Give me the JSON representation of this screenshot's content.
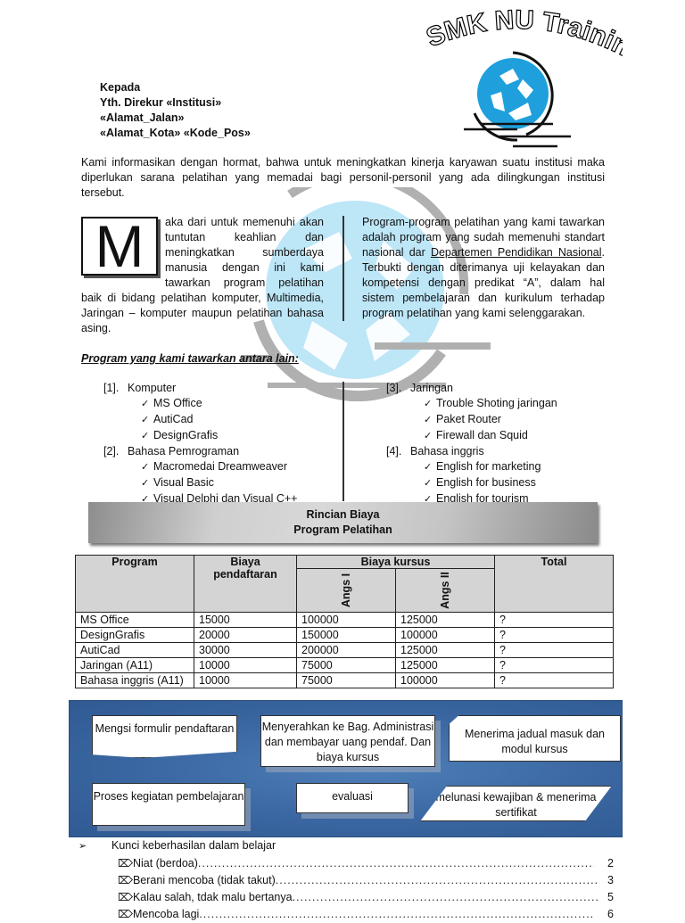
{
  "logo": {
    "title": "SMK NU Training Center",
    "emblem_icon": "recycle-icon",
    "accent_color": "#1fa0dc"
  },
  "address": {
    "line1": "Kepada",
    "line2": "Yth. Direkur «Institusi»",
    "line3": "«Alamat_Jalan»",
    "line4": "«Alamat_Kota» «Kode_Pos»"
  },
  "intro": "Kami informasikan dengan hormat, bahwa untuk meningkatkan kinerja karyawan suatu institusi maka diperlukan sarana pelatihan yang memadai bagi personil-personil yang ada dilingkungan institusi tersebut.",
  "left_column": {
    "drop_cap": "M",
    "text": "aka dari untuk memenuhi akan tuntutan keahlian dan meningkatkan sumberdaya manusia dengan ini kami tawarkan program pelatihan baik di bidang pelatihan komputer, Multimedia, Jaringan – komputer maupun pelatihan bahasa asing."
  },
  "right_column": {
    "text_before": "Program-program pelatihan yang kami tawarkan adalah program yang sudah memenuhi standart nasional dar ",
    "link_text": "Departemen Pendidikan Nasional",
    "text_after": ". Terbukti dengan diterimanya uji kelayakan dan kompetensi dengan predikat “A”, dalam hal sistem pembelajaran dan kurikulum terhadap program pelatihan yang kami selenggarakan."
  },
  "programs": {
    "heading": "Program yang kami tawarkan antara lain:",
    "check_icon": "✓",
    "left": [
      {
        "num": "[1].",
        "name": "Komputer",
        "items": [
          "MS Office",
          "AutiCad",
          "DesignGrafis"
        ]
      },
      {
        "num": "[2].",
        "name": "Bahasa Pemrograman",
        "items": [
          "Macromedai Dreamweaver",
          "Visual Basic",
          "Visual Delphi dan Visual C++"
        ]
      }
    ],
    "right": [
      {
        "num": "[3].",
        "name": "Jaringan",
        "items": [
          "Trouble Shoting jaringan",
          "Paket Router",
          "Firewall dan Squid"
        ]
      },
      {
        "num": "[4].",
        "name": "Bahasa inggris",
        "items": [
          "English for marketing",
          "English for business",
          "English for tourism"
        ]
      }
    ]
  },
  "banner": {
    "line1": "Rincian Biaya",
    "line2": "Program Pelatihan"
  },
  "fee_table": {
    "headers": {
      "program": "Program",
      "registration": "Biaya pendaftaran",
      "course": "Biaya kursus",
      "installment1": "Angs I",
      "installment2": "Angs II",
      "total": "Total"
    },
    "rows": [
      [
        "MS Office",
        "15000",
        "100000",
        "125000",
        "?"
      ],
      [
        "DesignGrafis",
        "20000",
        "150000",
        "100000",
        "?"
      ],
      [
        "AutiCad",
        "30000",
        "200000",
        "125000",
        "?"
      ],
      [
        "Jaringan (A11)",
        "10000",
        "75000",
        "125000",
        "?"
      ],
      [
        "Bahasa inggris (A11)",
        "10000",
        "75000",
        "100000",
        "?"
      ]
    ]
  },
  "flow": {
    "bg_color": "#3a66a1",
    "steps": [
      "Mengsi formulir pendaftaran",
      "Menyerahkan ke Bag. Administrasi dan membayar uang pendaf. Dan biaya kursus",
      "Menerima jadual masuk dan modul kursus",
      "Proses kegiatan pembelajaran",
      "evaluasi",
      "melunasi kewajiban & menerima sertifikat"
    ]
  },
  "keys": {
    "bullet": "➢",
    "heading": "Kunci keberhasilan dalam belajar",
    "box_icon": "⌦",
    "items": [
      {
        "label": "Niat (berdoa)",
        "num": "2"
      },
      {
        "label": "Berani mencoba (tidak takut) ",
        "num": "3"
      },
      {
        "label": "Kalau salah, tdak malu bertanya",
        "num": "5"
      },
      {
        "label": "Mencoba lagi",
        "num": "6"
      }
    ]
  }
}
